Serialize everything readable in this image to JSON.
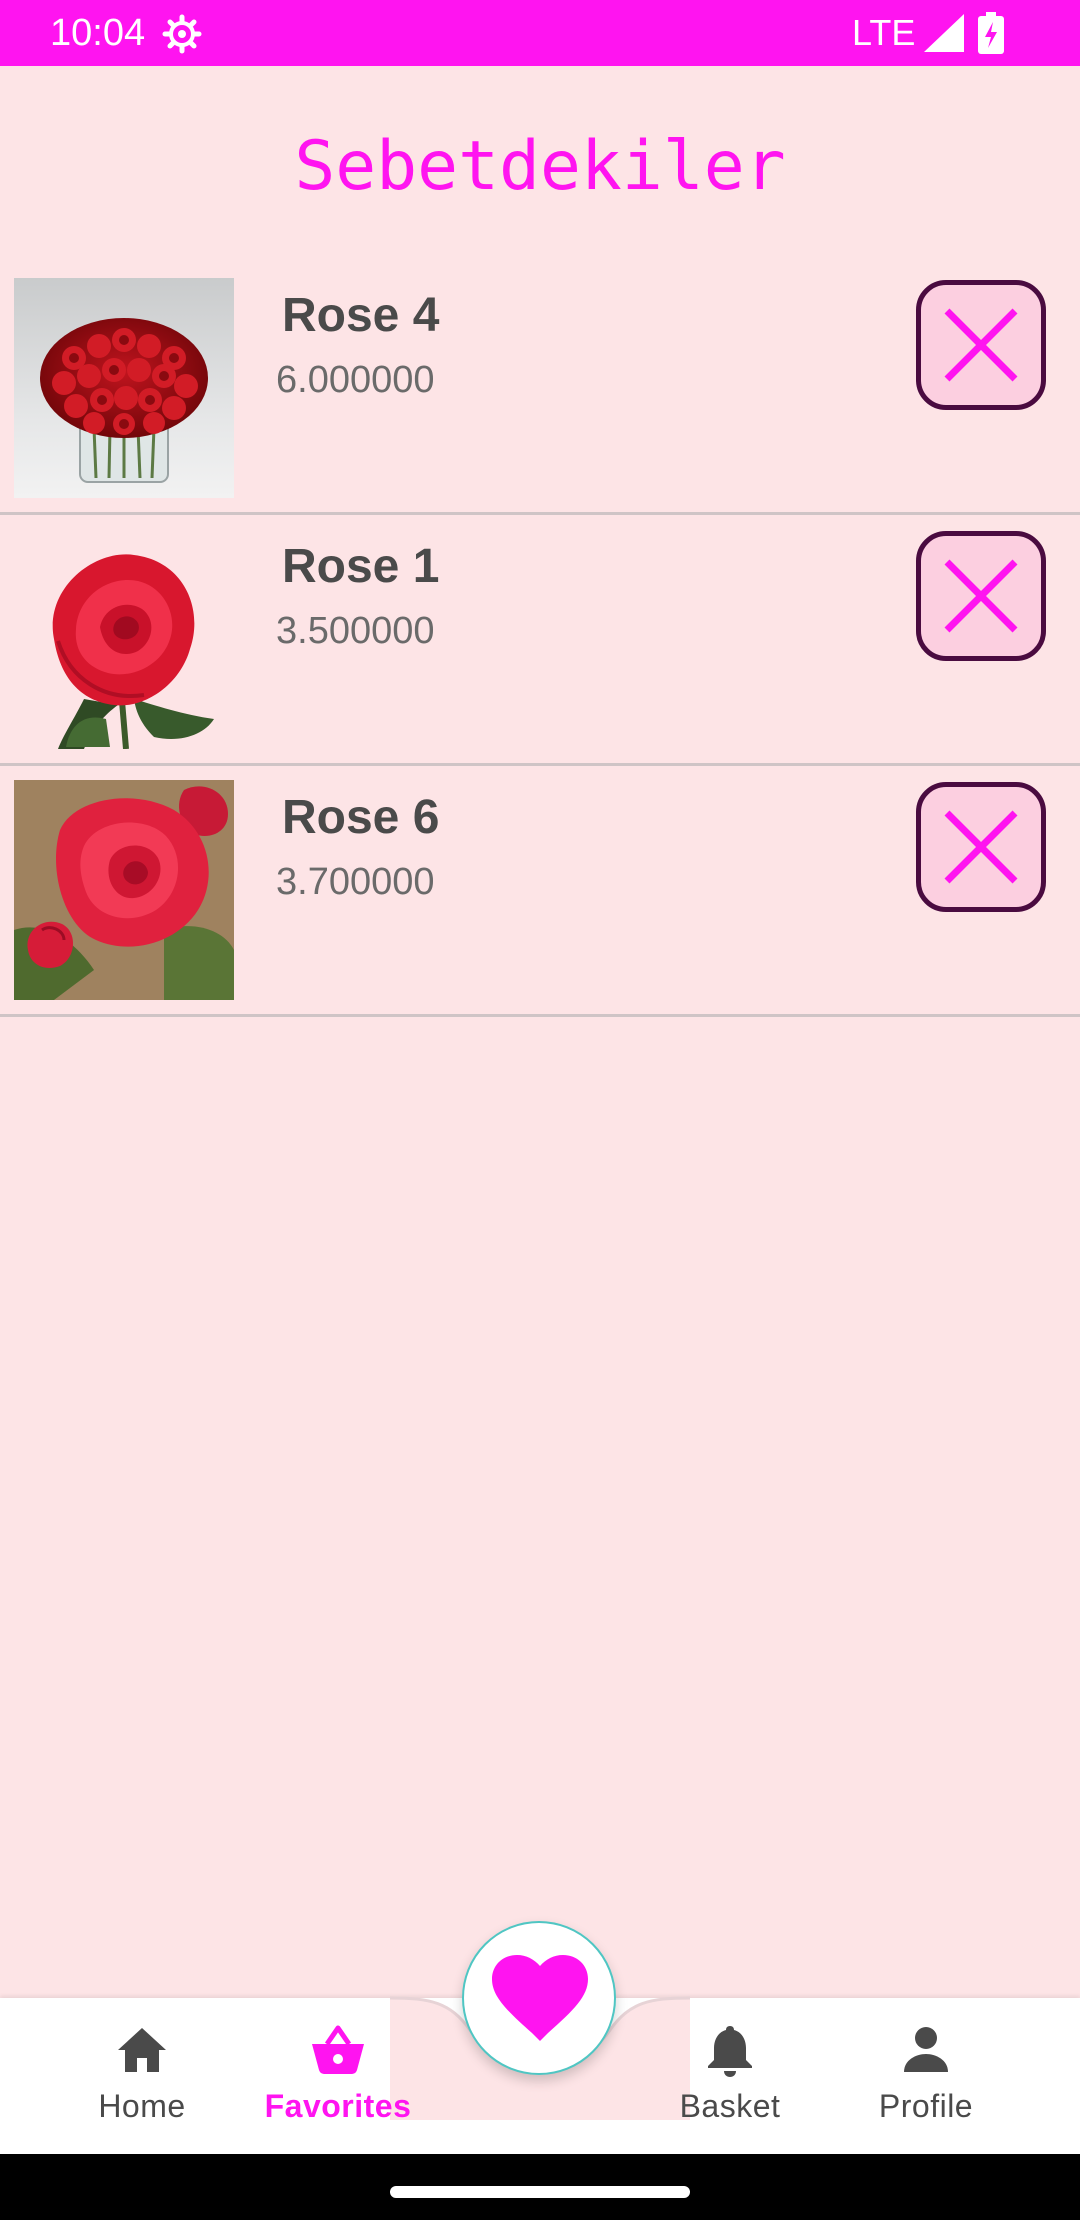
{
  "status_bar": {
    "time": "10:04",
    "network": "LTE",
    "color": "#ff14f0"
  },
  "page": {
    "title": "Sebetdekiler",
    "background": "#fde4e6",
    "accent": "#ff14f0"
  },
  "cart": {
    "items": [
      {
        "name": "Rose 4",
        "price": "6.000000",
        "image": "rose-bouquet-vase"
      },
      {
        "name": "Rose 1",
        "price": "3.500000",
        "image": "single-red-rose"
      },
      {
        "name": "Rose 6",
        "price": "3.700000",
        "image": "garden-rose"
      }
    ],
    "remove_icon": "close-icon"
  },
  "bottom_nav": {
    "items": [
      {
        "label": "Home",
        "icon": "home-icon",
        "active": false
      },
      {
        "label": "Favorites",
        "icon": "basket-icon",
        "active": true
      },
      {
        "label": "Basket",
        "icon": "bell-icon",
        "active": false
      },
      {
        "label": "Profile",
        "icon": "person-icon",
        "active": false
      }
    ],
    "fab_icon": "heart-icon"
  }
}
